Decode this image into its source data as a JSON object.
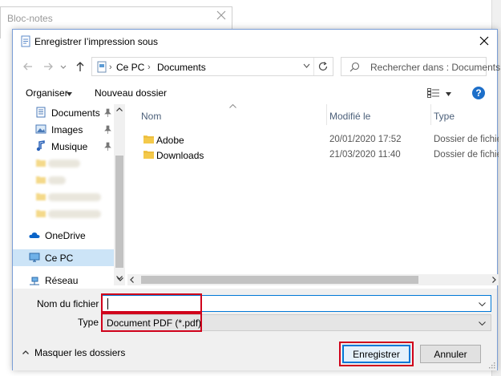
{
  "background_window": {
    "title": "Bloc-notes",
    "close_icon": "close-icon"
  },
  "dialog": {
    "title": "Enregistrer l’impression sous",
    "navigation": {
      "path": [
        "Ce PC",
        "Documents"
      ],
      "search_placeholder": "Rechercher dans : Documents"
    },
    "toolbar": {
      "organize": "Organiser",
      "new_folder": "Nouveau dossier"
    },
    "nav_pane": {
      "items": [
        {
          "label": "Documents",
          "icon": "documents-icon",
          "pinned": true
        },
        {
          "label": "Images",
          "icon": "images-icon",
          "pinned": true
        },
        {
          "label": "Musique",
          "icon": "music-icon",
          "pinned": true
        },
        {
          "label": "OneDrive",
          "icon": "onedrive-icon"
        },
        {
          "label": "Ce PC",
          "icon": "computer-icon",
          "selected": true
        },
        {
          "label": "Réseau",
          "icon": "network-icon"
        }
      ]
    },
    "file_list": {
      "columns": {
        "name": "Nom",
        "modified": "Modifié le",
        "type": "Type"
      },
      "rows": [
        {
          "name": "Adobe",
          "modified": "20/01/2020 17:52",
          "type": "Dossier de fichiers"
        },
        {
          "name": "Downloads",
          "modified": "21/03/2020 11:40",
          "type": "Dossier de fichiers"
        }
      ]
    },
    "form": {
      "filename_label": "Nom du fichier :",
      "filename_value": "",
      "type_label": "Type :",
      "type_value": "Document PDF (*.pdf)"
    },
    "footer": {
      "hide_folders": "Masquer les dossiers",
      "save": "Enregistrer",
      "cancel": "Annuler"
    }
  },
  "colors": {
    "accent": "#0078d7",
    "highlight": "#d0021b",
    "folder": "#f4c94a",
    "selection": "#cce4f7"
  }
}
